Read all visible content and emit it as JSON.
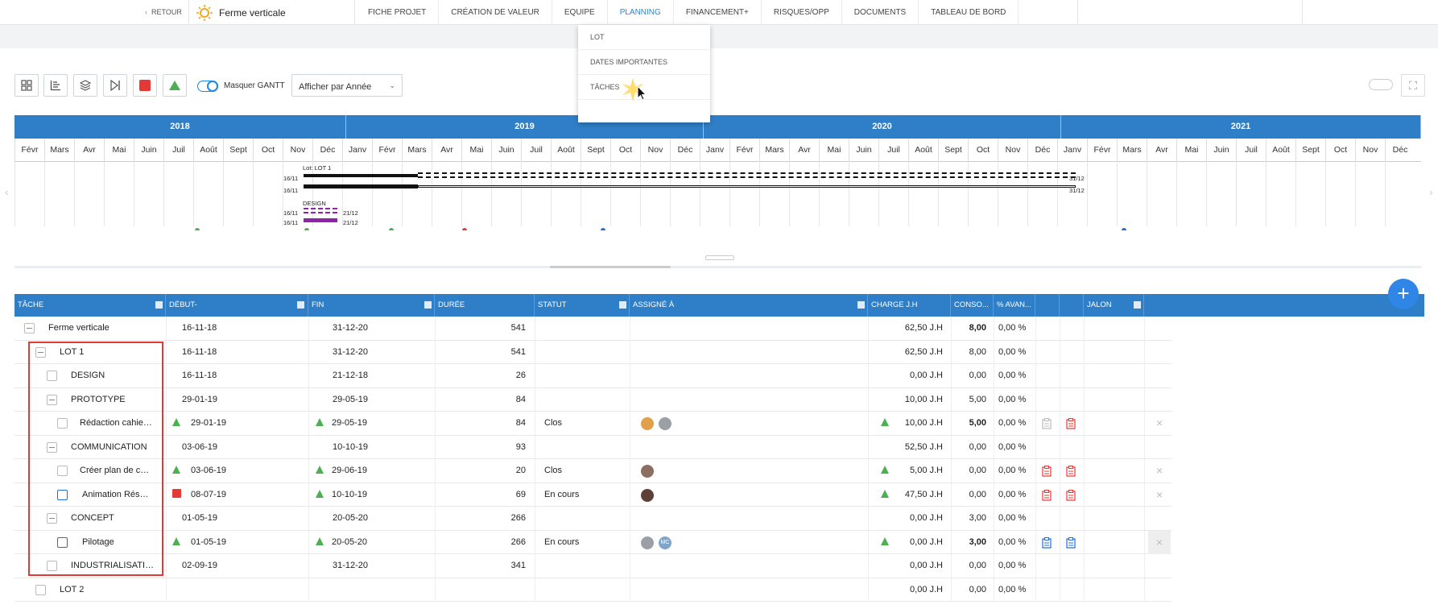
{
  "nav": {
    "back_label": "RETOUR",
    "project_title": "Ferme verticale",
    "tabs": [
      "FICHE PROJET",
      "CRÉATION DE VALEUR",
      "EQUIPE",
      "PLANNING",
      "FINANCEMENT+",
      "RISQUES/OPP",
      "DOCUMENTS",
      "TABLEAU DE BORD"
    ],
    "active_tab": "PLANNING"
  },
  "planning_menu": {
    "items": [
      "LOT",
      "DATES IMPORTANTES",
      "TÂCHES"
    ],
    "hovered": "TÂCHES"
  },
  "toolbar": {
    "mask_gantt_label": "Masquer GANTT",
    "view_select": "Afficher par Année",
    "icons": [
      "grid-icon",
      "gantt-bars-icon",
      "layers-icon",
      "skip-end-icon",
      "red-square-icon",
      "green-triangle-icon"
    ]
  },
  "gantt": {
    "years": [
      "2018",
      "2019",
      "2020",
      "2021"
    ],
    "months": [
      "Févr",
      "Mars",
      "Avr",
      "Mai",
      "Juin",
      "Juil",
      "Août",
      "Sept",
      "Oct",
      "Nov",
      "Déc",
      "Janv",
      "Févr",
      "Mars",
      "Avr",
      "Mai",
      "Juin",
      "Juil",
      "Août",
      "Sept",
      "Oct",
      "Nov",
      "Déc",
      "Janv",
      "Févr",
      "Mars",
      "Avr",
      "Mai",
      "Juin",
      "Juil",
      "Août",
      "Sept",
      "Oct",
      "Nov",
      "Déc",
      "Janv",
      "Févr",
      "Mars",
      "Avr",
      "Mai",
      "Juin",
      "Juil",
      "Août",
      "Sept",
      "Oct",
      "Nov",
      "Déc"
    ],
    "lot_label": "Lot: LOT 1",
    "design_label": "DESIGN",
    "bar_labels": {
      "start": "16/11",
      "end_lot": "31/12",
      "end_design": "21/12"
    },
    "colors": {
      "header": "#2f7fc8",
      "lot_bar": "#111111",
      "design_bar": "#8e24aa"
    }
  },
  "table": {
    "columns": [
      "TÂCHE",
      "DÉBUT-",
      "FIN",
      "DURÉE",
      "STATUT",
      "ASSIGNÉ À",
      "CHARGE J.H",
      "CONSO...",
      "% AVAN...",
      "",
      "",
      "JALON"
    ],
    "rows": [
      {
        "task": "Ferme verticale",
        "start": "16-11-18",
        "end": "31-12-20",
        "duration": "541",
        "status": "",
        "charge": "62,50 J.H",
        "conso": "8,00",
        "progress": "0,00 %"
      },
      {
        "task": "LOT 1",
        "start": "16-11-18",
        "end": "31-12-20",
        "duration": "541",
        "status": "",
        "charge": "62,50 J.H",
        "conso": "8,00",
        "progress": "0,00 %"
      },
      {
        "task": "DESIGN",
        "start": "16-11-18",
        "end": "21-12-18",
        "duration": "26",
        "status": "",
        "charge": "0,00 J.H",
        "conso": "0,00",
        "progress": "0,00 %"
      },
      {
        "task": "PROTOTYPE",
        "start": "29-01-19",
        "end": "29-05-19",
        "duration": "84",
        "status": "",
        "charge": "10,00 J.H",
        "conso": "5,00",
        "progress": "0,00 %"
      },
      {
        "task": "Rédaction cahie…",
        "start": "29-01-19",
        "end": "29-05-19",
        "duration": "84",
        "status": "Clos",
        "charge": "10,00 J.H",
        "conso": "5,00",
        "progress": "0,00 %"
      },
      {
        "task": "COMMUNICATION",
        "start": "03-06-19",
        "end": "10-10-19",
        "duration": "93",
        "status": "",
        "charge": "52,50 J.H",
        "conso": "0,00",
        "progress": "0,00 %"
      },
      {
        "task": "Créer plan de c…",
        "start": "03-06-19",
        "end": "29-06-19",
        "duration": "20",
        "status": "Clos",
        "charge": "5,00 J.H",
        "conso": "0,00",
        "progress": "0,00 %"
      },
      {
        "task": "Animation Rés…",
        "start": "08-07-19",
        "end": "10-10-19",
        "duration": "69",
        "status": "En cours",
        "charge": "47,50 J.H",
        "conso": "0,00",
        "progress": "0,00 %"
      },
      {
        "task": "CONCEPT",
        "start": "01-05-19",
        "end": "20-05-20",
        "duration": "266",
        "status": "",
        "charge": "0,00 J.H",
        "conso": "3,00",
        "progress": "0,00 %"
      },
      {
        "task": "Pilotage",
        "start": "01-05-19",
        "end": "20-05-20",
        "duration": "266",
        "status": "En cours",
        "charge": "0,00 J.H",
        "conso": "3,00",
        "progress": "0,00 %"
      },
      {
        "task": "INDUSTRIALISATI…",
        "start": "02-09-19",
        "end": "31-12-20",
        "duration": "341",
        "status": "",
        "charge": "0,00 J.H",
        "conso": "0,00",
        "progress": "0,00 %"
      },
      {
        "task": "LOT 2",
        "start": "",
        "end": "",
        "duration": "",
        "status": "",
        "charge": "0,00 J.H",
        "conso": "0,00",
        "progress": "0,00 %"
      }
    ],
    "avatar_initials": "MC"
  }
}
